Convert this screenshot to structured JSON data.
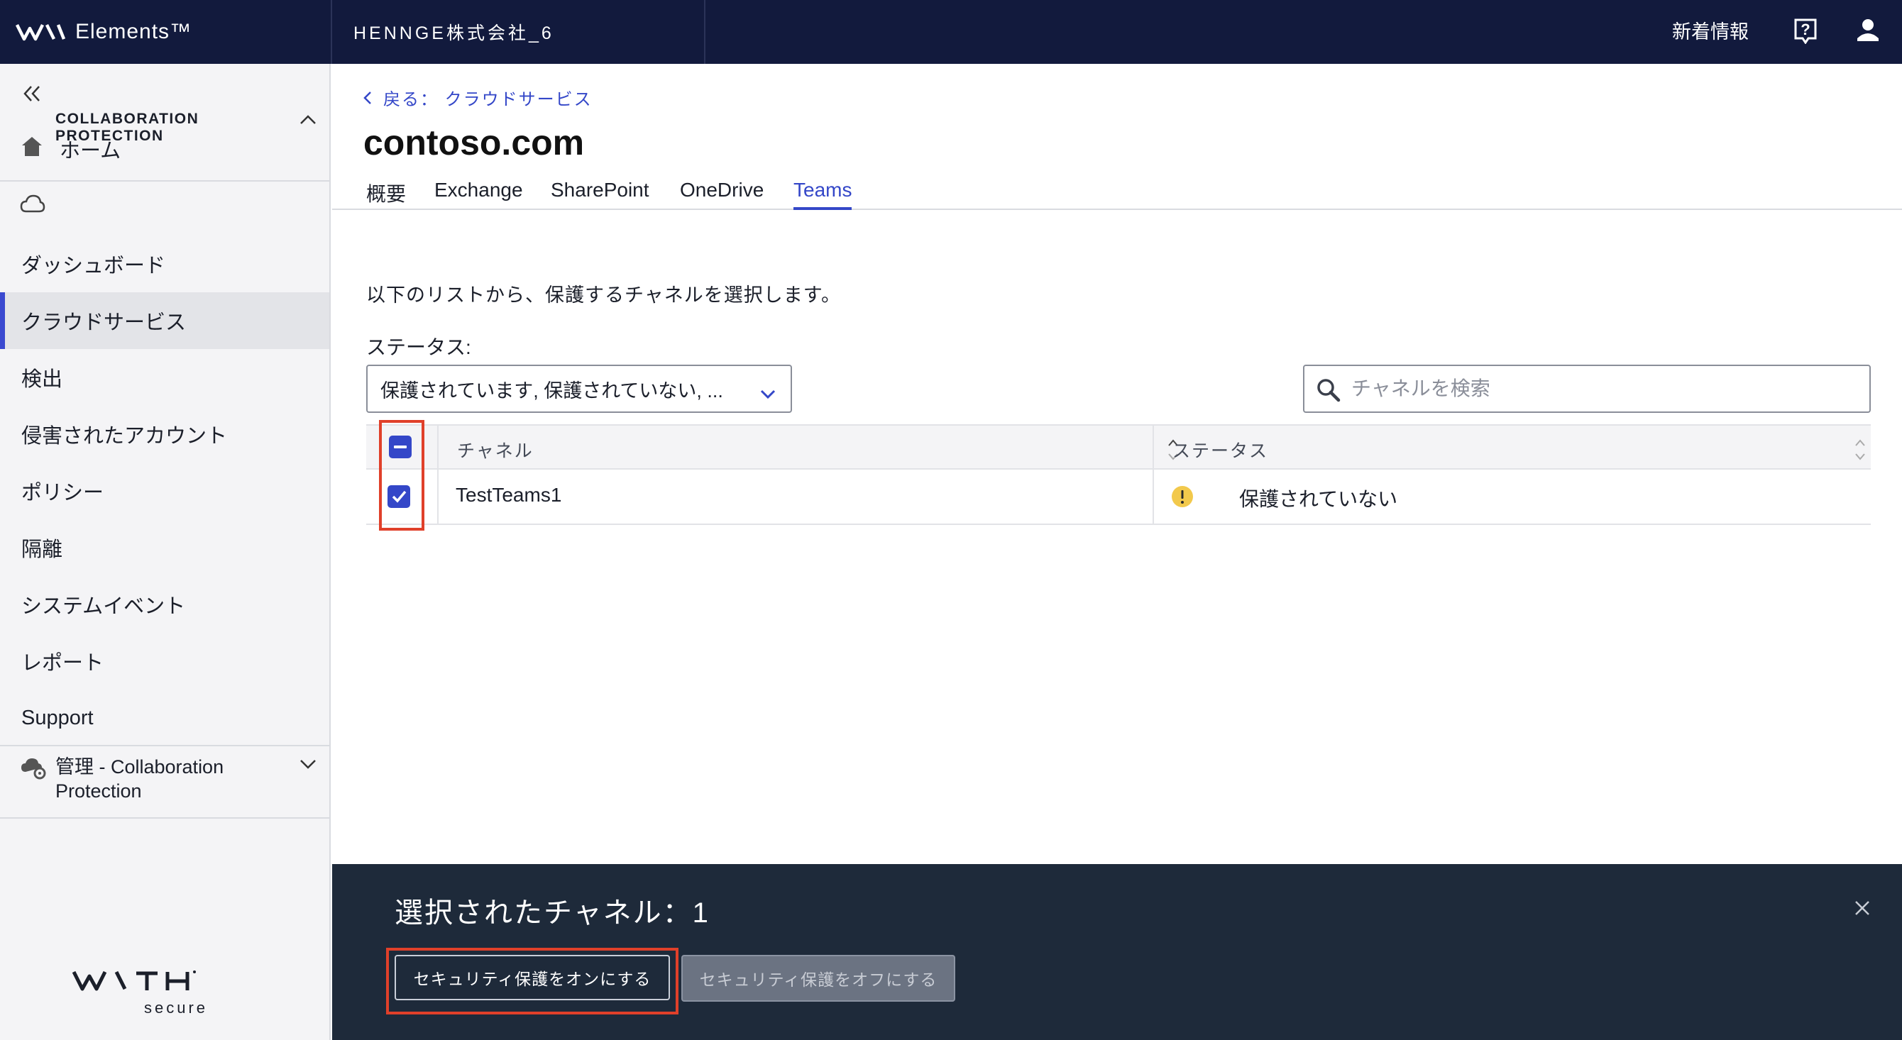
{
  "header": {
    "brand": "Elements™",
    "org": "HENNGE株式会社_6",
    "news": "新着情報"
  },
  "sidebar": {
    "home": "ホーム",
    "section_title": "COLLABORATION PROTECTION",
    "items": [
      {
        "label": "ダッシュボード"
      },
      {
        "label": "クラウドサービス",
        "active": true
      },
      {
        "label": "検出"
      },
      {
        "label": "侵害されたアカウント"
      },
      {
        "label": "ポリシー"
      },
      {
        "label": "隔離"
      },
      {
        "label": "システムイベント"
      },
      {
        "label": "レポート"
      },
      {
        "label": "Support"
      }
    ],
    "admin": "管理 - Collaboration Protection",
    "footer_logo": "WITH secure"
  },
  "main": {
    "breadcrumb": "戻る： クラウドサービス",
    "title": "contoso.com",
    "tabs": [
      {
        "label": "概要"
      },
      {
        "label": "Exchange"
      },
      {
        "label": "SharePoint"
      },
      {
        "label": "OneDrive"
      },
      {
        "label": "Teams",
        "active": true
      }
    ],
    "instruction": "以下のリストから、保護するチャネルを選択します。",
    "status_label": "ステータス:",
    "status_filter_value": "保護されています, 保護されていない, ...",
    "search_placeholder": "チャネルを検索",
    "table": {
      "columns": [
        "チャネル",
        "ステータス"
      ],
      "rows": [
        {
          "channel": "TestTeams1",
          "status": "保護されていない",
          "checked": true
        }
      ]
    }
  },
  "action_bar": {
    "title": "選択されたチャネル：1",
    "btn_on": "セキュリティ保護をオンにする",
    "btn_off": "セキュリティ保護をオフにする"
  },
  "colors": {
    "topbar": "#121a3d",
    "accent": "#3447c8",
    "action_bar": "#1e2a3a",
    "highlight": "#e0402a",
    "warning": "#f2c94c"
  }
}
